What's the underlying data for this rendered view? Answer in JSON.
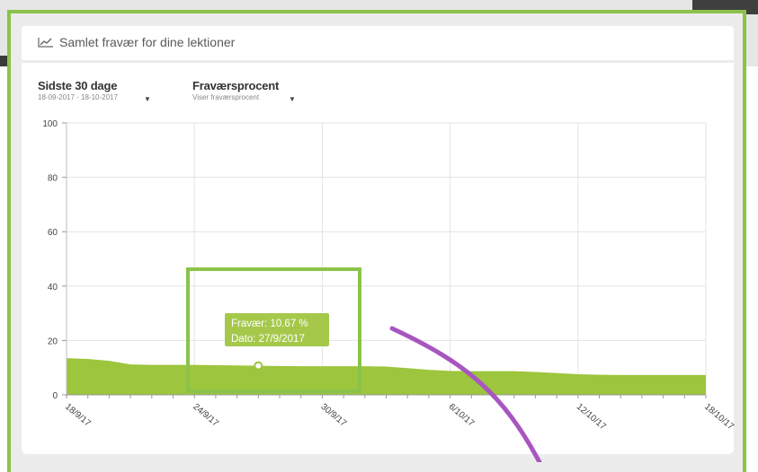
{
  "card": {
    "title": "Samlet fravær for dine lektioner",
    "icon": "line-chart-icon"
  },
  "filters": {
    "period": {
      "label": "Sidste 30 dage",
      "range": "18-09-2017 - 18-10-2017"
    },
    "metric": {
      "label": "Fraværsprocent",
      "description": "Viser fraværsprocent"
    }
  },
  "tooltip": {
    "line1": "Fravær: 10.67 %",
    "line2": "Dato: 27/9/2017"
  },
  "colors": {
    "accent": "#8bc34a",
    "series": "#9dc53d",
    "tooltip_bg": "#a5c84b",
    "annotation": "#a855c0"
  },
  "chart_data": {
    "type": "area",
    "x_ticks": [
      "18/9/17",
      "24/9/17",
      "30/9/17",
      "6/10/17",
      "12/10/17",
      "18/10/17"
    ],
    "y_ticks": [
      "0",
      "20",
      "40",
      "60",
      "80",
      "100"
    ],
    "ylim": [
      0,
      100
    ],
    "x": [
      "18/9/17",
      "19/9/17",
      "20/9/17",
      "21/9/17",
      "22/9/17",
      "23/9/17",
      "24/9/17",
      "25/9/17",
      "26/9/17",
      "27/9/17",
      "28/9/17",
      "29/9/17",
      "30/9/17",
      "1/10/17",
      "2/10/17",
      "3/10/17",
      "4/10/17",
      "5/10/17",
      "6/10/17",
      "7/10/17",
      "8/10/17",
      "9/10/17",
      "10/10/17",
      "11/10/17",
      "12/10/17",
      "13/10/17",
      "14/10/17",
      "15/10/17",
      "16/10/17",
      "17/10/17",
      "18/10/17"
    ],
    "values": [
      13.5,
      13.2,
      12.5,
      11.2,
      11.0,
      11.0,
      11.0,
      10.9,
      10.8,
      10.67,
      10.6,
      10.5,
      10.5,
      10.5,
      10.5,
      10.4,
      9.8,
      9.2,
      8.8,
      8.7,
      8.7,
      8.7,
      8.4,
      8.0,
      7.6,
      7.4,
      7.3,
      7.3,
      7.3,
      7.3,
      7.3
    ],
    "highlight": {
      "x": "27/9/2017",
      "value": 10.67
    },
    "grid": true
  }
}
